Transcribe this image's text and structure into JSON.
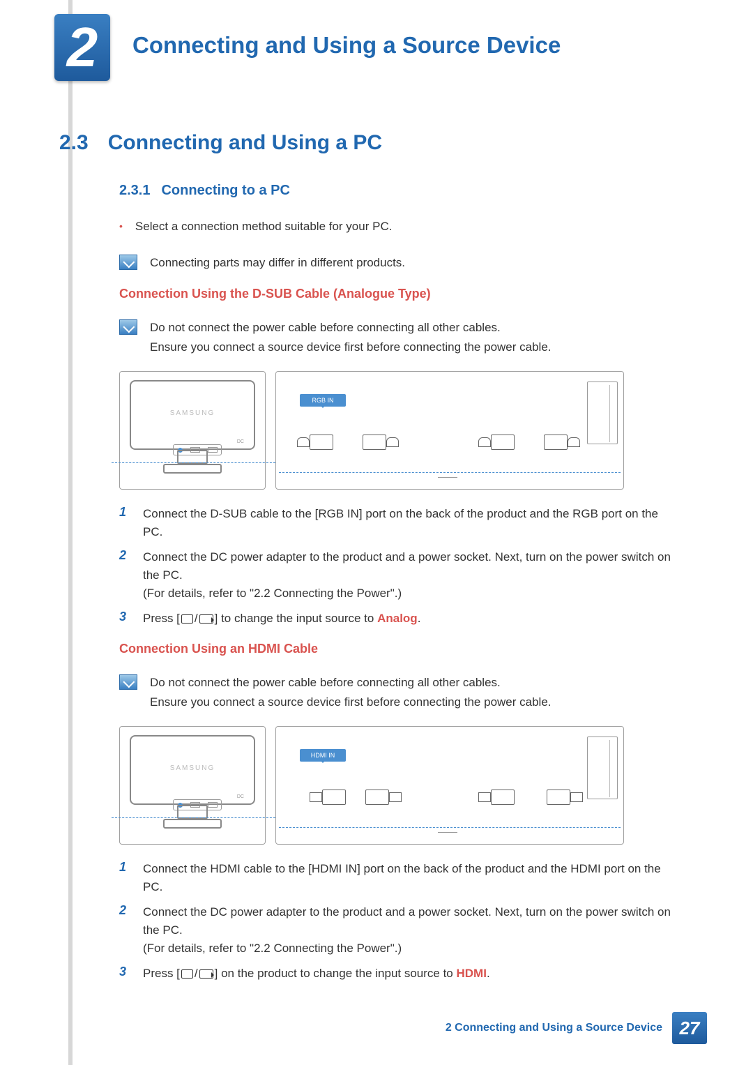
{
  "chapter": {
    "number": "2",
    "title": "Connecting and Using a Source Device"
  },
  "section": {
    "number": "2.3",
    "title": "Connecting and Using a PC"
  },
  "subsection": {
    "number": "2.3.1",
    "title": "Connecting to a PC"
  },
  "bullets": {
    "b1": "Select a connection method suitable for your PC."
  },
  "notes": {
    "n1": "Connecting parts may differ in different products.",
    "n2a": "Do not connect the power cable before connecting all other cables.",
    "n2b": "Ensure you connect a source device first before connecting the power cable.",
    "n3a": "Do not connect the power cable before connecting all other cables.",
    "n3b": "Ensure you connect a source device first before connecting the power cable."
  },
  "dsub": {
    "heading": "Connection Using the D-SUB Cable (Analogue Type)",
    "port_label": "RGB IN",
    "brand": "SAMSUNG",
    "dc": "DC",
    "steps": {
      "s1": "Connect the D-SUB cable to the [RGB IN] port on the back of the product and the RGB port on the PC.",
      "s2a": "Connect the DC power adapter to the product and a power socket. Next, turn on the power switch on the PC.",
      "s2b": "(For details, refer to \"2.2 Connecting the Power\".)",
      "s3a": "Press [",
      "s3b": "] to change the input source to ",
      "s3hl": "Analog",
      "s3c": "."
    }
  },
  "hdmi": {
    "heading": "Connection Using an HDMI Cable",
    "port_label": "HDMI IN",
    "brand": "SAMSUNG",
    "dc": "DC",
    "steps": {
      "s1": "Connect the HDMI cable to the [HDMI IN] port on the back of the product and the HDMI port on the PC.",
      "s2a": "Connect the DC power adapter to the product and a power socket. Next, turn on the power switch on the PC.",
      "s2b": "(For details, refer to \"2.2 Connecting the Power\".)",
      "s3a": "Press [",
      "s3b": "] on the product to change the input source to ",
      "s3hl": "HDMI",
      "s3c": "."
    }
  },
  "step_nums": {
    "one": "1",
    "two": "2",
    "three": "3"
  },
  "footer": {
    "text": "2 Connecting and Using a Source Device",
    "page": "27"
  }
}
